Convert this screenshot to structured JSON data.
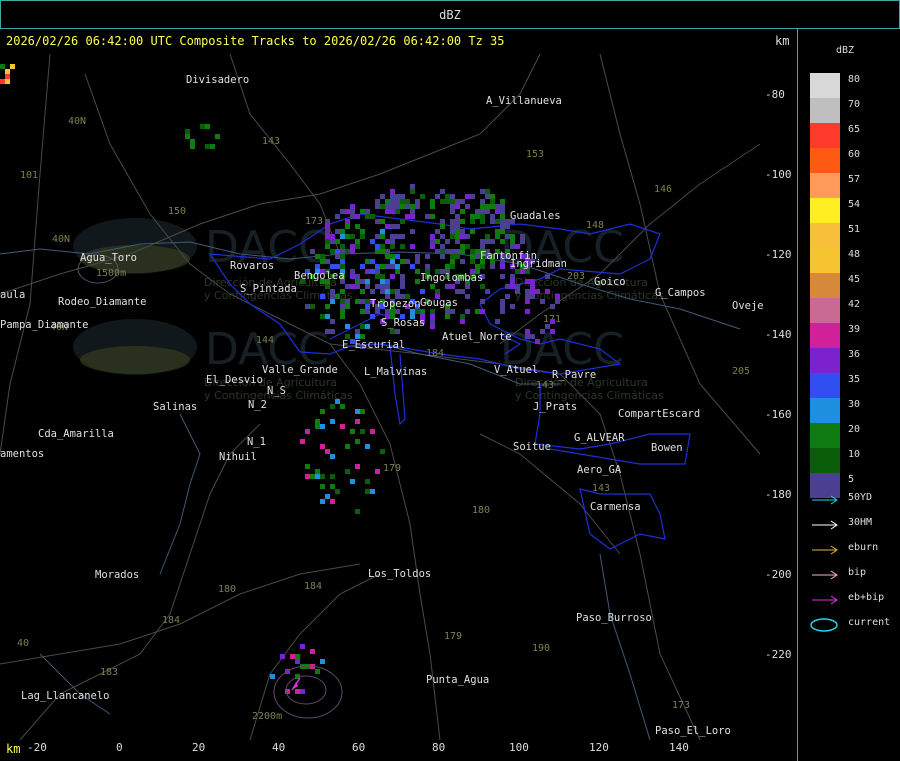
{
  "window": {
    "title": "dBZ"
  },
  "header": {
    "subtitle": "2026/02/26 06:42:00 UTC Composite Tracks to 2026/02/26 06:42:00 Tz 35",
    "units_top": "km",
    "units_bottom": "km"
  },
  "axes": {
    "x_ticks": [
      "-20",
      "0",
      "20",
      "40",
      "60",
      "80",
      "100",
      "120",
      "140"
    ],
    "y_ticks": [
      "-80",
      "-100",
      "-120",
      "-140",
      "-160",
      "-180",
      "-200",
      "-220"
    ]
  },
  "legend": {
    "title": "dBZ",
    "scale": [
      {
        "value": "80",
        "color": "#d9d9d9"
      },
      {
        "value": "70",
        "color": "#bfbfbf"
      },
      {
        "value": "65",
        "color": "#ff3a2a"
      },
      {
        "value": "60",
        "color": "#ff5a14"
      },
      {
        "value": "57",
        "color": "#ff9a5a"
      },
      {
        "value": "54",
        "color": "#ffee22"
      },
      {
        "value": "51",
        "color": "#f8c03a"
      },
      {
        "value": "48",
        "color": "#f5c430"
      },
      {
        "value": "45",
        "color": "#d88a3c"
      },
      {
        "value": "42",
        "color": "#c86a92"
      },
      {
        "value": "39",
        "color": "#d0209a"
      },
      {
        "value": "36",
        "color": "#7b22cc"
      },
      {
        "value": "35",
        "color": "#2f4ff0"
      },
      {
        "value": "30",
        "color": "#1f8fe0"
      },
      {
        "value": "20",
        "color": "#0f7a0f"
      },
      {
        "value": "10",
        "color": "#0a5e0a"
      },
      {
        "value": "5",
        "color": "#4a3f90"
      }
    ],
    "tracks": [
      {
        "label": "50YD",
        "color": "#22d8e8"
      },
      {
        "label": "30HM",
        "color": "#ffffff"
      },
      {
        "label": "eburn",
        "color": "#e8b04a"
      },
      {
        "label": "bip",
        "color": "#ffb0c0"
      },
      {
        "label": "eb+bip",
        "color": "#e030e0"
      },
      {
        "label": "current",
        "color": "#22d8e8"
      }
    ]
  },
  "map": {
    "places": [
      {
        "name": "Divisadero"
      },
      {
        "name": "A_Villanueva"
      },
      {
        "name": "Guadales"
      },
      {
        "name": "Goico"
      },
      {
        "name": "G_Campos"
      },
      {
        "name": "Ovejer"
      },
      {
        "name": "Agua_Toro"
      },
      {
        "name": "Rodeo_Diamante"
      },
      {
        "name": "aula"
      },
      {
        "name": "Pampa_Diamante"
      },
      {
        "name": "Rovaros"
      },
      {
        "name": "S_Pintada"
      },
      {
        "name": "E_Escurial"
      },
      {
        "name": "S_Rosas"
      },
      {
        "name": "Atuel_Norte"
      },
      {
        "name": "Valle_Grande"
      },
      {
        "name": "L_Malvinas"
      },
      {
        "name": "V_Atuel"
      },
      {
        "name": "R_Pavre"
      },
      {
        "name": "El_Desvio"
      },
      {
        "name": "N_S"
      },
      {
        "name": "N_2"
      },
      {
        "name": "Salinas"
      },
      {
        "name": "Cda_Amarilla"
      },
      {
        "name": "amentos"
      },
      {
        "name": "N_1"
      },
      {
        "name": "Nihuil"
      },
      {
        "name": "J_Prats"
      },
      {
        "name": "CompartEscard"
      },
      {
        "name": "G_ALVEAR"
      },
      {
        "name": "Soitue"
      },
      {
        "name": "Bowen"
      },
      {
        "name": "Aero_GA"
      },
      {
        "name": "Carmensa"
      },
      {
        "name": "Morados"
      },
      {
        "name": "Los_Toldos"
      },
      {
        "name": "Paso_Burroso"
      },
      {
        "name": "Punta_Agua"
      },
      {
        "name": "Lag_Llancanelo"
      },
      {
        "name": "Paso_El_Loro"
      },
      {
        "name": "Gougas"
      },
      {
        "name": "Ingolombas"
      },
      {
        "name": "Tropezon"
      },
      {
        "name": "Bengolea"
      },
      {
        "name": "Fantonfin"
      },
      {
        "name": "Ingridman"
      }
    ],
    "routes": [
      "40N",
      "40N",
      "101",
      "40N",
      "150",
      "143",
      "153",
      "146",
      "148",
      "203",
      "171",
      "144",
      "173",
      "184",
      "143",
      "179",
      "180",
      "184",
      "190",
      "184",
      "183",
      "179",
      "143",
      "205",
      "40"
    ],
    "elevations": [
      "1500m",
      "2200m"
    ],
    "watermark": {
      "brand": "DACC",
      "line1": "Dirección de Agricultura",
      "line2": "y Contingencias Climáticas"
    }
  }
}
